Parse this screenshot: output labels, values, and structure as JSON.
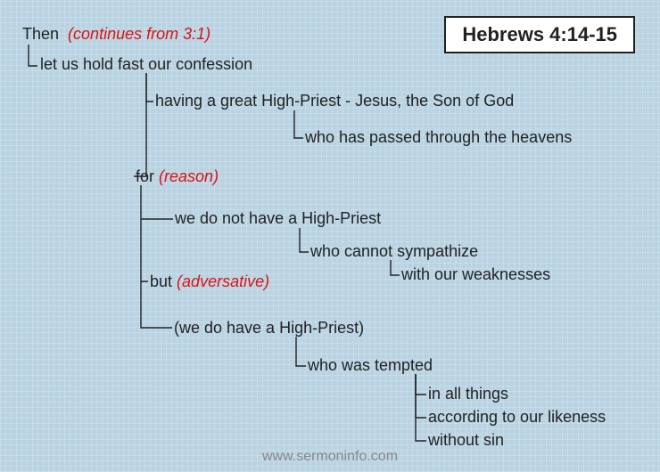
{
  "title": "Hebrews 4:14-15",
  "footer": "www.sermoninfo.com",
  "nodes": {
    "then": "Then",
    "then_ann": "(continues from 3:1)",
    "hold": "let us hold fast our confession",
    "having": "having a great High-Priest - Jesus, the Son of God",
    "passed": "who has passed through the heavens",
    "for": "for",
    "for_ann": "(reason)",
    "not_have": "we do not have a High-Priest",
    "cannot": "who cannot sympathize",
    "weak": "with our weaknesses",
    "but": "but",
    "but_ann": "(adversative)",
    "do_have": "(we do have a High-Priest)",
    "tempted": "who was tempted",
    "all": "in all things",
    "likeness": "according to our likeness",
    "sin": "without sin"
  }
}
